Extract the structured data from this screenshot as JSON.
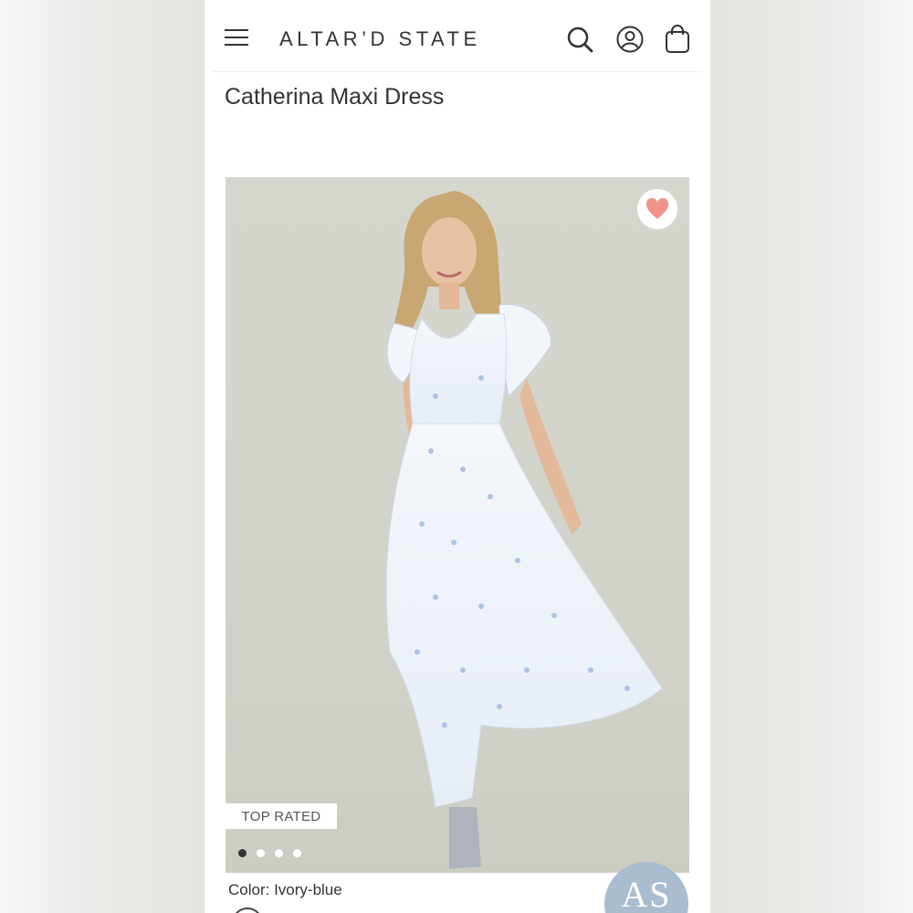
{
  "header": {
    "brand": "ALTAR’D STATE",
    "menu_icon": "hamburger-menu-icon",
    "search_icon": "search-icon",
    "account_icon": "account-icon",
    "bag_icon": "shopping-bag-icon"
  },
  "product": {
    "title": "Catherina Maxi Dress",
    "badge": "TOP RATED",
    "color_label": "Color: Ivory-blue",
    "image_count": 4,
    "active_image": 1,
    "favorite_icon": "heart-icon"
  },
  "chat_badge": {
    "text": "AS"
  },
  "colors": {
    "heart": "#f2938b",
    "text": "#333333",
    "as_badge": "#a9bcd0"
  }
}
